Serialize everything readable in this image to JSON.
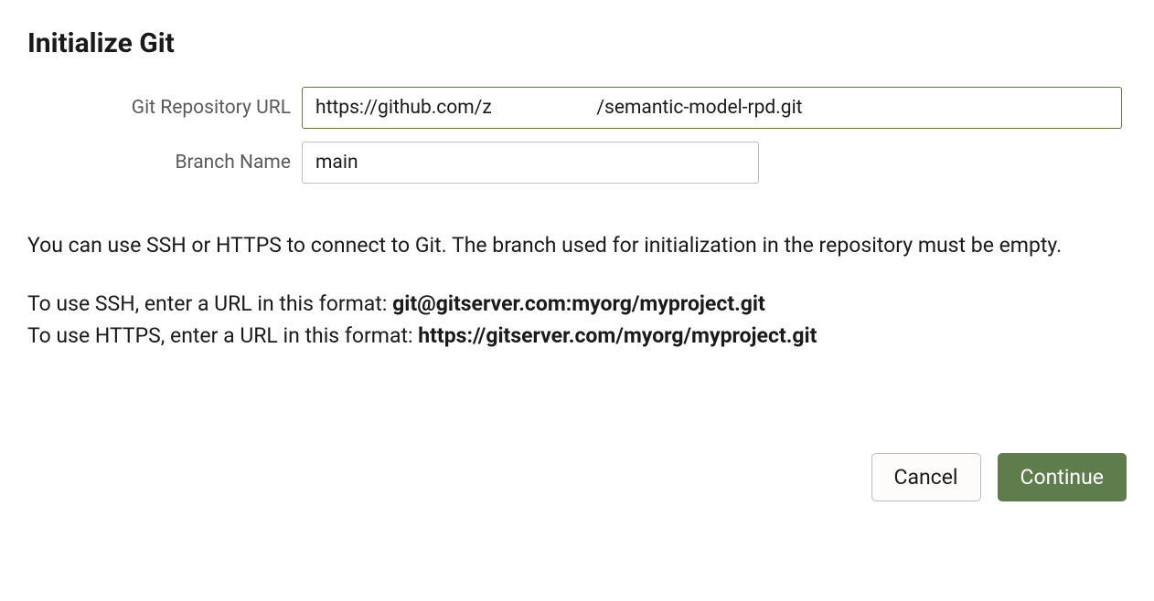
{
  "title": "Initialize Git",
  "form": {
    "url": {
      "label": "Git Repository URL",
      "value": "https://github.com/z                      /semantic-model-rpd.git"
    },
    "branch": {
      "label": "Branch Name",
      "value": "main"
    }
  },
  "help": {
    "intro": "You can use SSH or HTTPS to connect to Git. The branch used for initialization in the repository must be empty.",
    "ssh_prefix": "To use SSH, enter a URL in this format: ",
    "ssh_example": "git@gitserver.com:myorg/myproject.git",
    "https_prefix": "To use HTTPS, enter a URL in this format: ",
    "https_example": "https://gitserver.com/myorg/myproject.git"
  },
  "buttons": {
    "cancel": "Cancel",
    "continue": "Continue"
  }
}
